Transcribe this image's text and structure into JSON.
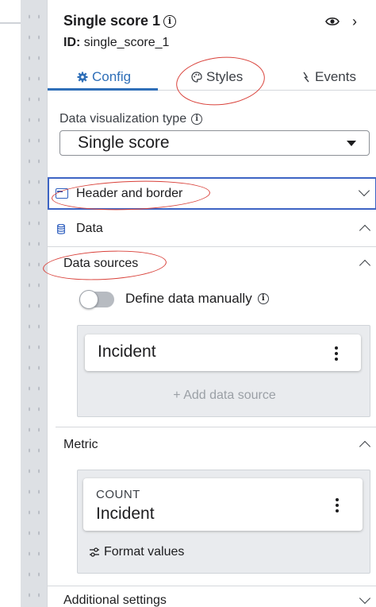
{
  "panel": {
    "title": "Single score 1",
    "id_label": "ID:",
    "id_value": "single_score_1"
  },
  "tabs": [
    {
      "label": "Config",
      "icon": "gear-icon",
      "active": true
    },
    {
      "label": "Styles",
      "icon": "palette-icon",
      "active": false
    },
    {
      "label": "Events",
      "icon": "lightning-icon",
      "active": false
    }
  ],
  "visualization": {
    "label": "Data visualization type",
    "selected": "Single score"
  },
  "sections": {
    "header_border": "Header and border",
    "data": "Data",
    "data_sources": "Data sources",
    "metric": "Metric",
    "additional_settings": "Additional settings"
  },
  "data_sources": {
    "toggle_label": "Define data manually",
    "toggle_on": false,
    "source_name": "Incident",
    "add_label": "+ Add data source"
  },
  "metric": {
    "aggregation": "COUNT",
    "table": "Incident",
    "format_label": "Format values"
  },
  "colors": {
    "accent": "#2f6fb8",
    "selected_border": "#3d64c4",
    "annotation": "#d9413a"
  }
}
